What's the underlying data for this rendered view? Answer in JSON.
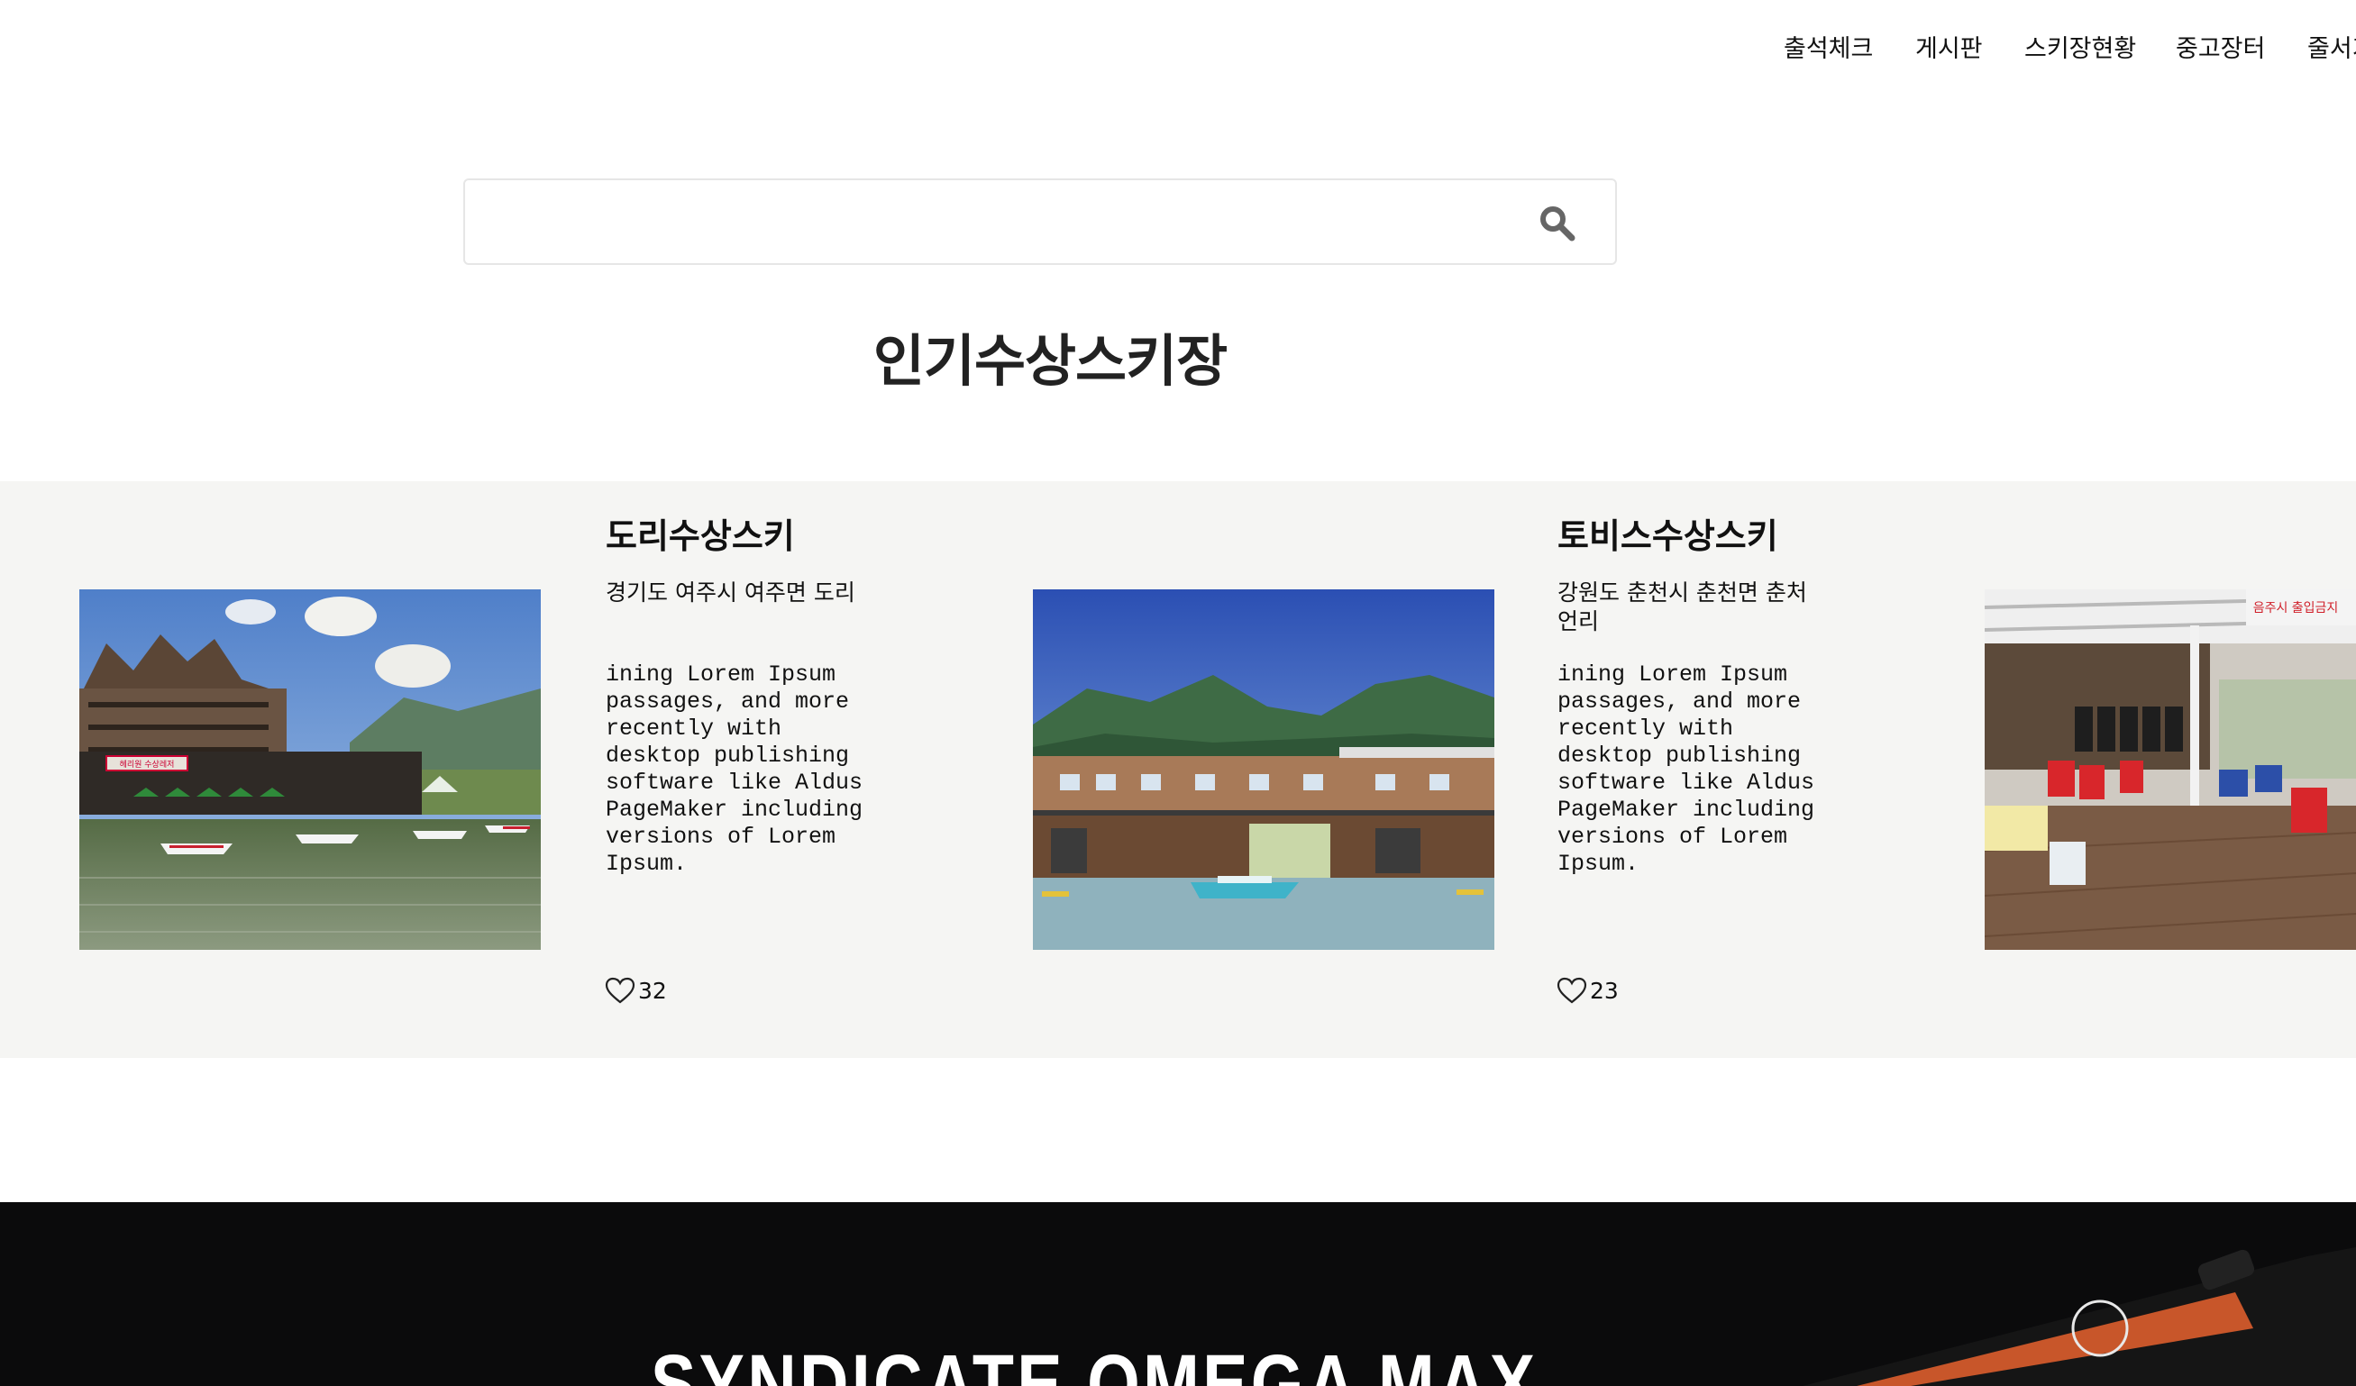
{
  "nav": {
    "items": [
      "출석체크",
      "게시판",
      "스키장현황",
      "중고장터",
      "줄서기"
    ]
  },
  "search": {
    "value": "",
    "placeholder": "",
    "icon": "search-icon"
  },
  "section": {
    "title": "인기수상스키장"
  },
  "cards": [
    {
      "title": "도리수상스키",
      "address": "경기도 여주시 여주면 도리",
      "description": "ining Lorem Ipsum passages, and more recently with desktop publishing software like Aldus PageMaker including versions of Lorem Ipsum.",
      "likes": "32"
    },
    {
      "title": "토비스수상스키",
      "address": "강원도 춘천시 춘천면 춘처언리",
      "description": "ining Lorem Ipsum passages, and more recently with desktop publishing software like Aldus PageMaker including versions of Lorem Ipsum.",
      "likes": "23"
    }
  ],
  "photo_signs": {
    "resort": "헤리원 수상레저",
    "shop": "음주시 출입금지"
  },
  "banner": {
    "title": "SYNDICATE OMEGA MAX"
  },
  "colors": {
    "band_bg": "#f5f5f3",
    "banner_bg": "#0b0b0c",
    "heart_stroke": "#222222"
  }
}
